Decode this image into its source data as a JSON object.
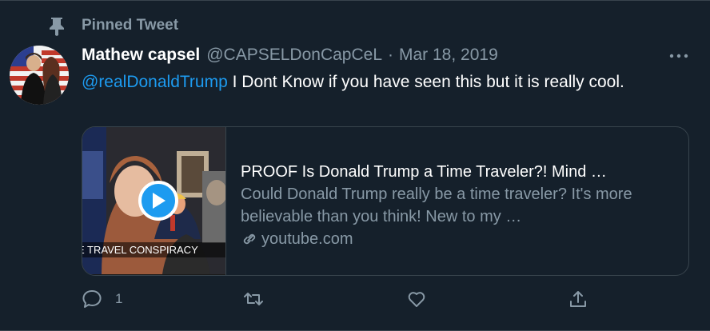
{
  "pinned": {
    "label": "Pinned Tweet",
    "icon": "pin-icon"
  },
  "author": {
    "display_name": "Mathew capsel",
    "handle": "@CAPSELDonCapCeL",
    "separator": "·",
    "timestamp": "Mar 18, 2019",
    "avatar_icon": "avatar"
  },
  "more_icon": "more-icon",
  "tweet": {
    "mention": "@realDonaldTrump",
    "text": " I Dont Know if you have seen this but it is really cool."
  },
  "card": {
    "thumbnail_caption": "E TRAVEL CONSPIRACY",
    "title": "PROOF Is Donald Trump a Time Traveler?! Mind …",
    "description": "Could Donald Trump really be a time traveler? It's more believable than you think! New to my …",
    "domain": "youtube.com",
    "play_icon": "play-icon",
    "link_icon": "link-icon"
  },
  "actions": {
    "reply": {
      "icon": "reply-icon",
      "count": "1"
    },
    "retweet": {
      "icon": "retweet-icon",
      "count": ""
    },
    "like": {
      "icon": "heart-icon",
      "count": ""
    },
    "share": {
      "icon": "share-icon",
      "count": ""
    }
  },
  "colors": {
    "background": "#15202b",
    "border": "#38444d",
    "secondary_text": "#8899a6",
    "accent": "#1d9bf0"
  }
}
